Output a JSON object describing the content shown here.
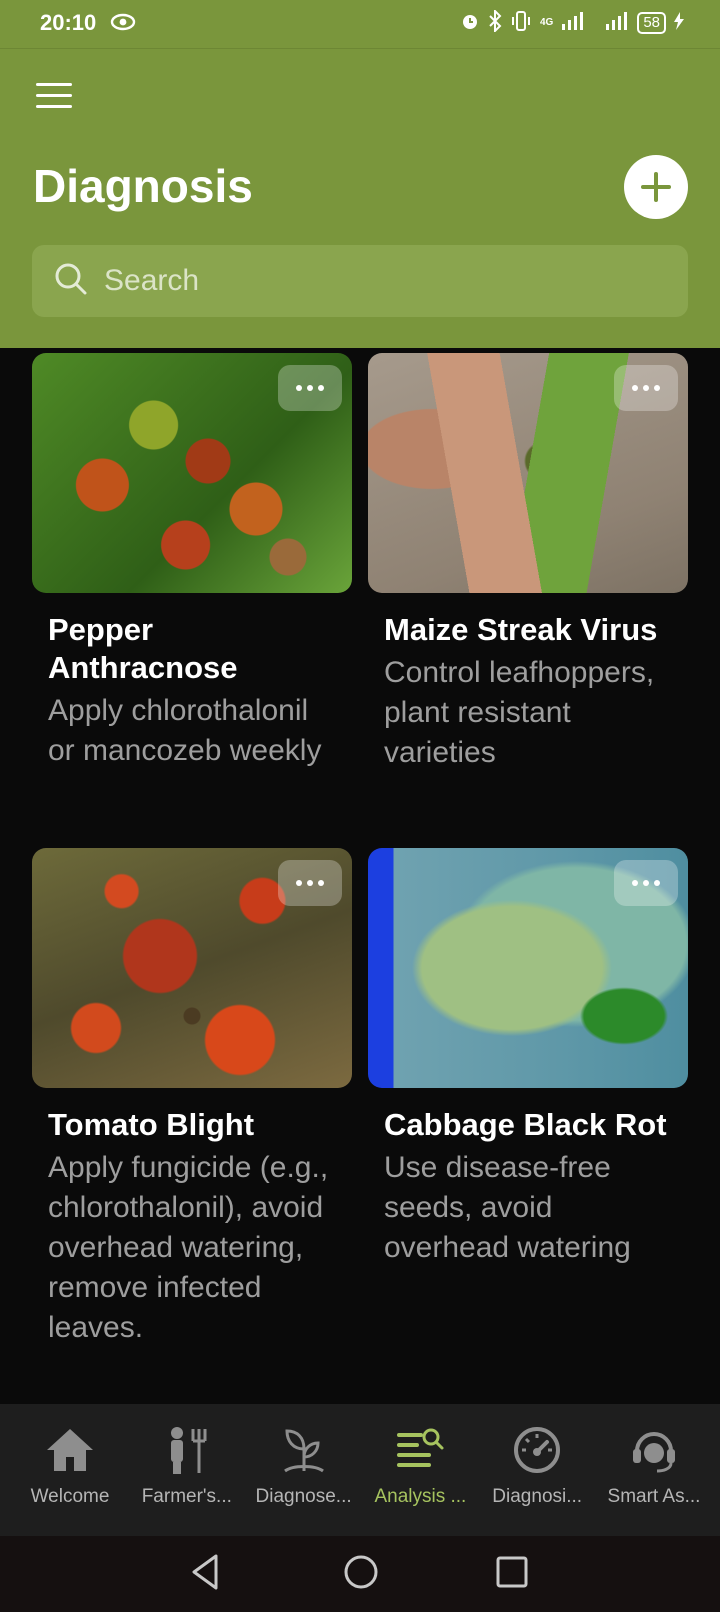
{
  "status_bar": {
    "time": "20:10",
    "battery": "58",
    "network": "4G"
  },
  "header": {
    "title": "Diagnosis"
  },
  "search": {
    "placeholder": "Search"
  },
  "cards": [
    {
      "title": "Pepper Anthracnose",
      "description": "Apply chlorothalonil or mancozeb weekly"
    },
    {
      "title": "Maize Streak Virus",
      "description": "Control leafhoppers, plant resistant varieties"
    },
    {
      "title": "Tomato Blight",
      "description": "Apply fungicide (e.g., chlorothalonil), avoid overhead watering, remove infected leaves."
    },
    {
      "title": "Cabbage Black Rot",
      "description": "Use disease-free seeds, avoid overhead watering"
    }
  ],
  "bottom_nav": [
    {
      "label": "Welcome",
      "icon": "home-icon"
    },
    {
      "label": "Farmer's...",
      "icon": "farmer-tools-icon"
    },
    {
      "label": "Diagnose...",
      "icon": "plant-icon"
    },
    {
      "label": "Analysis ...",
      "icon": "analysis-search-icon",
      "active": true
    },
    {
      "label": "Diagnosi...",
      "icon": "gauge-icon"
    },
    {
      "label": "Smart As...",
      "icon": "assistant-headset-icon"
    }
  ],
  "colors": {
    "header_bg": "#7a963c",
    "active_nav": "#a6c35f",
    "background": "#0a0a0a"
  }
}
